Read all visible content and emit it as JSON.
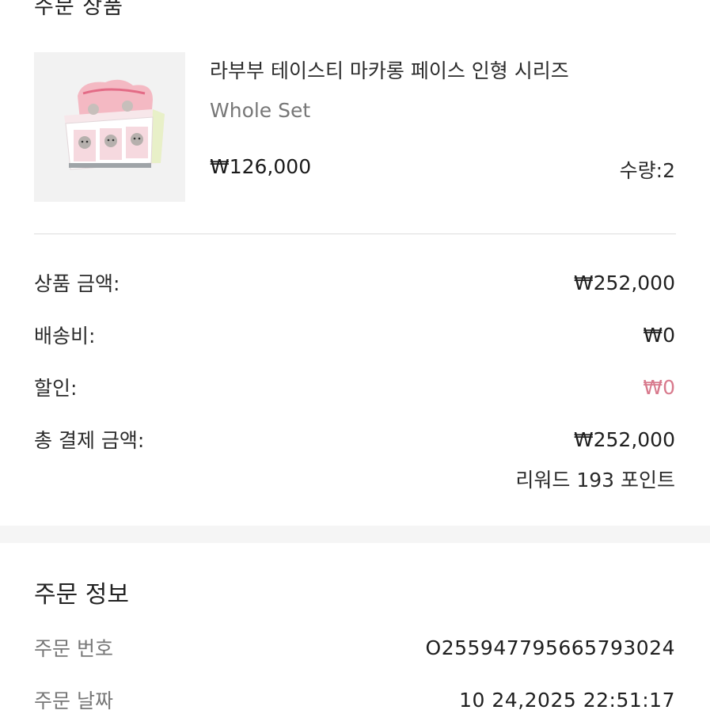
{
  "section": {
    "title": "주문 상품"
  },
  "product": {
    "name": "라부부 테이스티 마카롱 페이스 인형 시리즈",
    "variant": "Whole Set",
    "price": "₩126,000",
    "quantity": "수량:2",
    "thumbnail_icon": "product-box-image"
  },
  "summary": {
    "subtotal_label": "상품 금액:",
    "subtotal_value": "₩252,000",
    "shipping_label": "배송비:",
    "shipping_value": "₩0",
    "discount_label": "할인:",
    "discount_value": "₩0",
    "total_label": "총 결제 금액:",
    "total_value": "₩252,000",
    "reward": "리워드 193 포인트",
    "discount_color": "#d87a8d"
  },
  "order_info": {
    "title": "주문 정보",
    "order_number_label": "주문 번호",
    "order_number_value": "O255947795665793024",
    "order_date_label": "주문 날짜",
    "order_date_value": "10 24,2025 22:51:17"
  }
}
